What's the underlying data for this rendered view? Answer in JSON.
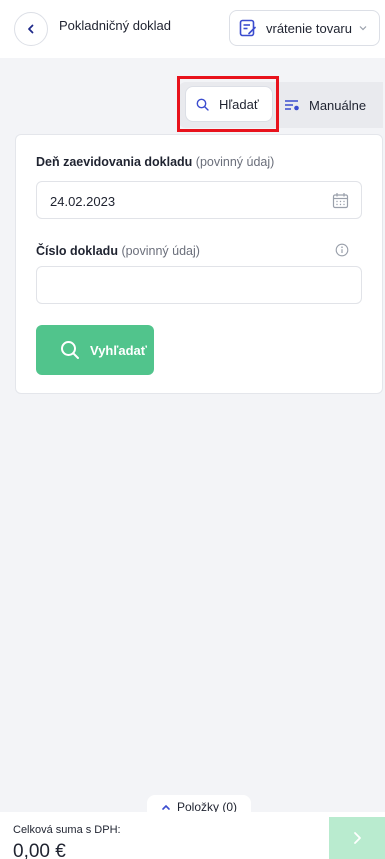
{
  "header": {
    "title": "Pokladničný doklad",
    "doc_type": "vrátenie tovaru"
  },
  "mode": {
    "search_label": "Hľadať",
    "manual_label": "Manuálne"
  },
  "form": {
    "date_label": "Deň zaevidovania dokladu",
    "date_required": "(povinný údaj)",
    "date_value": "24.02.2023",
    "number_label": "Číslo dokladu",
    "number_required": "(povinný údaj)",
    "number_value": "",
    "search_button": "Vyhľadať"
  },
  "footer": {
    "items_tab": "Položky (0)",
    "total_label": "Celková suma s DPH:",
    "total_value": "0,00 €"
  },
  "colors": {
    "accent_green": "#51c48c",
    "disabled_green": "#b9ebcf",
    "highlight_red": "#e8121c",
    "icon_blue": "#3b4ccf"
  }
}
